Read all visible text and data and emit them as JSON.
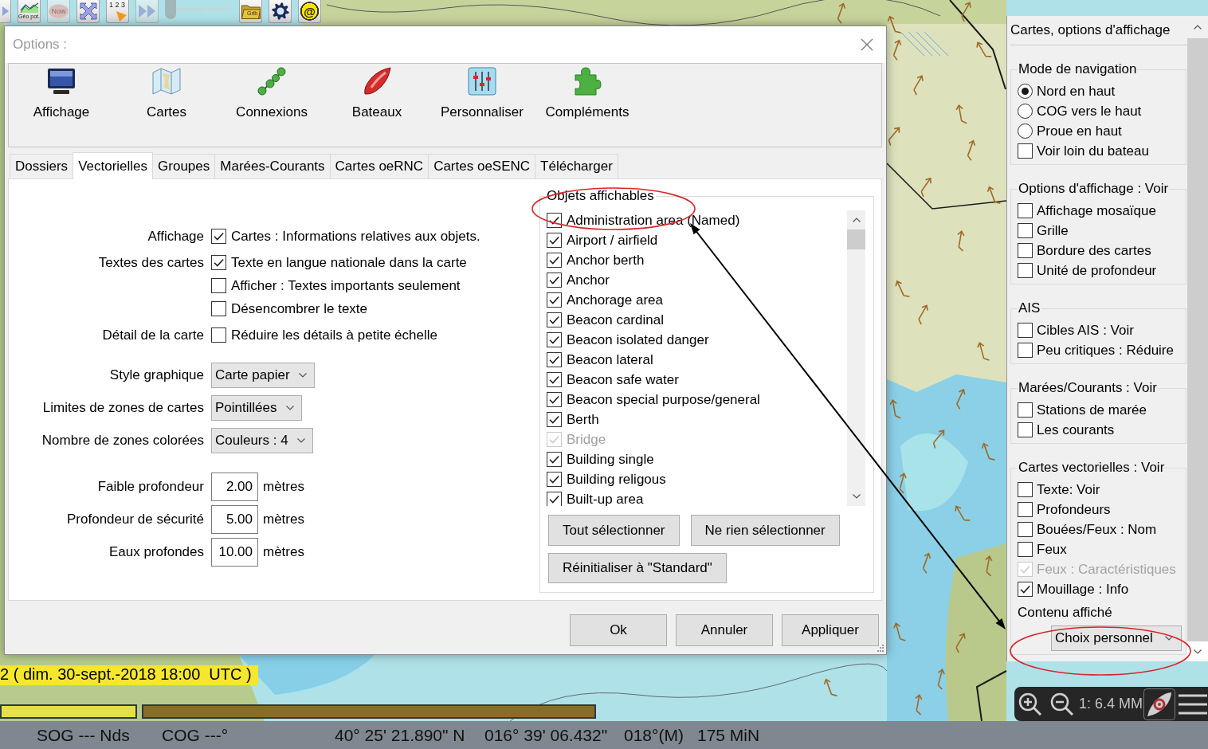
{
  "toolbar": [
    {
      "kind": "arrow",
      "disabled": false
    },
    {
      "kind": "geo",
      "label": "Géo pot.",
      "disabled": false
    },
    {
      "kind": "now",
      "label": "Now",
      "disabled": true
    },
    {
      "kind": "fit",
      "disabled": false
    },
    {
      "kind": "numbers",
      "label": "1 2 3",
      "disabled": false
    },
    {
      "kind": "forward",
      "disabled": true
    },
    {
      "kind": "slider",
      "level": 0,
      "disabled": true
    },
    {
      "kind": "grib",
      "label": "Grib",
      "disabled": false
    },
    {
      "kind": "settings",
      "disabled": false
    },
    {
      "kind": "email",
      "label": "@",
      "disabled": false
    }
  ],
  "map": {
    "time_label": "2 ( dim. 30-sept.-2018 18:00  UTC )",
    "time_bars": [
      {
        "color": "#e6df45"
      },
      {
        "color": "#8b6b2b"
      }
    ]
  },
  "dialog": {
    "title": "Options :",
    "categories": [
      {
        "kind": "display",
        "label": "Affichage"
      },
      {
        "kind": "charts",
        "label": "Cartes"
      },
      {
        "kind": "connections",
        "label": "Connexions"
      },
      {
        "kind": "ships",
        "label": "Bateaux"
      },
      {
        "kind": "user",
        "label": "Personnaliser"
      },
      {
        "kind": "plugins",
        "label": "Compléments"
      }
    ],
    "tabs": [
      {
        "label": "Dossiers",
        "selected": false
      },
      {
        "label": "Vectorielles",
        "selected": true
      },
      {
        "label": "Groupes",
        "selected": false
      },
      {
        "label": "Marées-Courants",
        "selected": false
      },
      {
        "label": "Cartes oeRNC",
        "selected": false
      },
      {
        "label": "Cartes oeSENC",
        "selected": false
      },
      {
        "label": "Télécharger",
        "selected": false
      }
    ],
    "settings": [
      {
        "kind": "checkbox",
        "label": "Affichage",
        "text": "Cartes : Informations relatives aux objets.",
        "checked": true
      },
      {
        "kind": "checkbox",
        "label": "Textes des cartes",
        "text": "Texte en langue nationale dans la carte",
        "checked": true
      },
      {
        "kind": "checkbox",
        "text": "Afficher : Textes importants seulement",
        "checked": false
      },
      {
        "kind": "checkbox",
        "text": "Désencombrer le texte",
        "checked": false
      },
      {
        "kind": "checkbox",
        "label": "Détail de la carte",
        "text": "Réduire les détails à petite échelle",
        "checked": false
      },
      {
        "kind": "select",
        "label": "Style graphique",
        "value": "Carte papier"
      },
      {
        "kind": "select",
        "label": "Limites de zones de cartes",
        "value": "Pointillées"
      },
      {
        "kind": "select",
        "label": "Nombre de zones colorées",
        "value": "Couleurs : 4"
      },
      {
        "kind": "number",
        "label": "Faible profondeur",
        "value": "2.00",
        "unit": "mètres"
      },
      {
        "kind": "number",
        "label": "Profondeur de sécurité",
        "value": "5.00",
        "unit": "mètres"
      },
      {
        "kind": "number",
        "label": "Eaux profondes",
        "value": "10.00",
        "unit": "mètres"
      }
    ],
    "objects": {
      "title": "Objets affichables",
      "items": [
        {
          "label": "Administration area (Named)",
          "checked": true,
          "disabled": false
        },
        {
          "label": "Airport / airfield",
          "checked": true,
          "disabled": false
        },
        {
          "label": "Anchor berth",
          "checked": true,
          "disabled": false
        },
        {
          "label": "Anchor",
          "checked": true,
          "disabled": false
        },
        {
          "label": "Anchorage area",
          "checked": true,
          "disabled": false
        },
        {
          "label": "Beacon cardinal",
          "checked": true,
          "disabled": false
        },
        {
          "label": "Beacon isolated danger",
          "checked": true,
          "disabled": false
        },
        {
          "label": "Beacon lateral",
          "checked": true,
          "disabled": false
        },
        {
          "label": "Beacon safe water",
          "checked": true,
          "disabled": false
        },
        {
          "label": "Beacon special purpose/general",
          "checked": true,
          "disabled": false
        },
        {
          "label": "Berth",
          "checked": true,
          "disabled": false
        },
        {
          "label": "Bridge",
          "checked": true,
          "disabled": true
        },
        {
          "label": "Building single",
          "checked": true,
          "disabled": false
        },
        {
          "label": "Building religous",
          "checked": true,
          "disabled": false
        },
        {
          "label": "Built-up area",
          "checked": true,
          "disabled": false
        }
      ],
      "buttons": [
        "Tout sélectionner",
        "Ne rien sélectionner",
        "Réinitialiser à \"Standard\""
      ]
    },
    "buttons": [
      "Ok",
      "Annuler",
      "Appliquer"
    ]
  },
  "panel": {
    "title": "Cartes, options d'affichage",
    "groups": [
      {
        "title": "Mode de navigation",
        "items": [
          {
            "kind": "radio",
            "label": "Nord en haut",
            "selected": true,
            "disabled": false
          },
          {
            "kind": "radio",
            "label": "COG vers le haut",
            "selected": false,
            "disabled": false
          },
          {
            "kind": "radio",
            "label": "Proue en haut",
            "selected": false,
            "disabled": false
          },
          {
            "kind": "checkbox",
            "label": "Voir loin du bateau",
            "checked": false,
            "disabled": false
          }
        ]
      },
      {
        "title": "Options d'affichage : Voir",
        "items": [
          {
            "kind": "checkbox",
            "label": "Affichage mosaïque",
            "checked": false,
            "disabled": false
          },
          {
            "kind": "checkbox",
            "label": "Grille",
            "checked": false,
            "disabled": false
          },
          {
            "kind": "checkbox",
            "label": "Bordure des cartes",
            "checked": false,
            "disabled": false
          },
          {
            "kind": "checkbox",
            "label": "Unité de profondeur",
            "checked": false,
            "disabled": false
          }
        ]
      },
      {
        "title": "AIS",
        "items": [
          {
            "kind": "checkbox",
            "label": "Cibles AIS : Voir",
            "checked": false,
            "disabled": false
          },
          {
            "kind": "checkbox",
            "label": "Peu critiques : Réduire",
            "checked": false,
            "disabled": false
          }
        ]
      },
      {
        "title": "Marées/Courants : Voir",
        "items": [
          {
            "kind": "checkbox",
            "label": "Stations de marée",
            "checked": false,
            "disabled": false
          },
          {
            "kind": "checkbox",
            "label": "Les courants",
            "checked": false,
            "disabled": false
          }
        ]
      },
      {
        "title": "Cartes vectorielles : Voir",
        "items": [
          {
            "kind": "checkbox",
            "label": "Texte: Voir",
            "checked": false,
            "disabled": false
          },
          {
            "kind": "checkbox",
            "label": "Profondeurs",
            "checked": false,
            "disabled": false
          },
          {
            "kind": "checkbox",
            "label": "Bouées/Feux : Nom",
            "checked": false,
            "disabled": false
          },
          {
            "kind": "checkbox",
            "label": "Feux",
            "checked": false,
            "disabled": false
          },
          {
            "kind": "checkbox",
            "label": "Feux : Caractéristiques",
            "checked": true,
            "disabled": true
          },
          {
            "kind": "checkbox",
            "label": "Mouillage : Info",
            "checked": true,
            "disabled": false
          }
        ],
        "content": {
          "label": "Contenu affiché",
          "value": "Choix personnel"
        }
      }
    ]
  },
  "map_controls": {
    "scale": "1: 6.4 MM"
  },
  "status_bar": {
    "fields": [
      "SOG --- Nds",
      "COG ---°",
      "40° 25' 21.890\" N",
      "016° 39' 06.432\"",
      "018°(M)",
      "175 MiN"
    ]
  }
}
